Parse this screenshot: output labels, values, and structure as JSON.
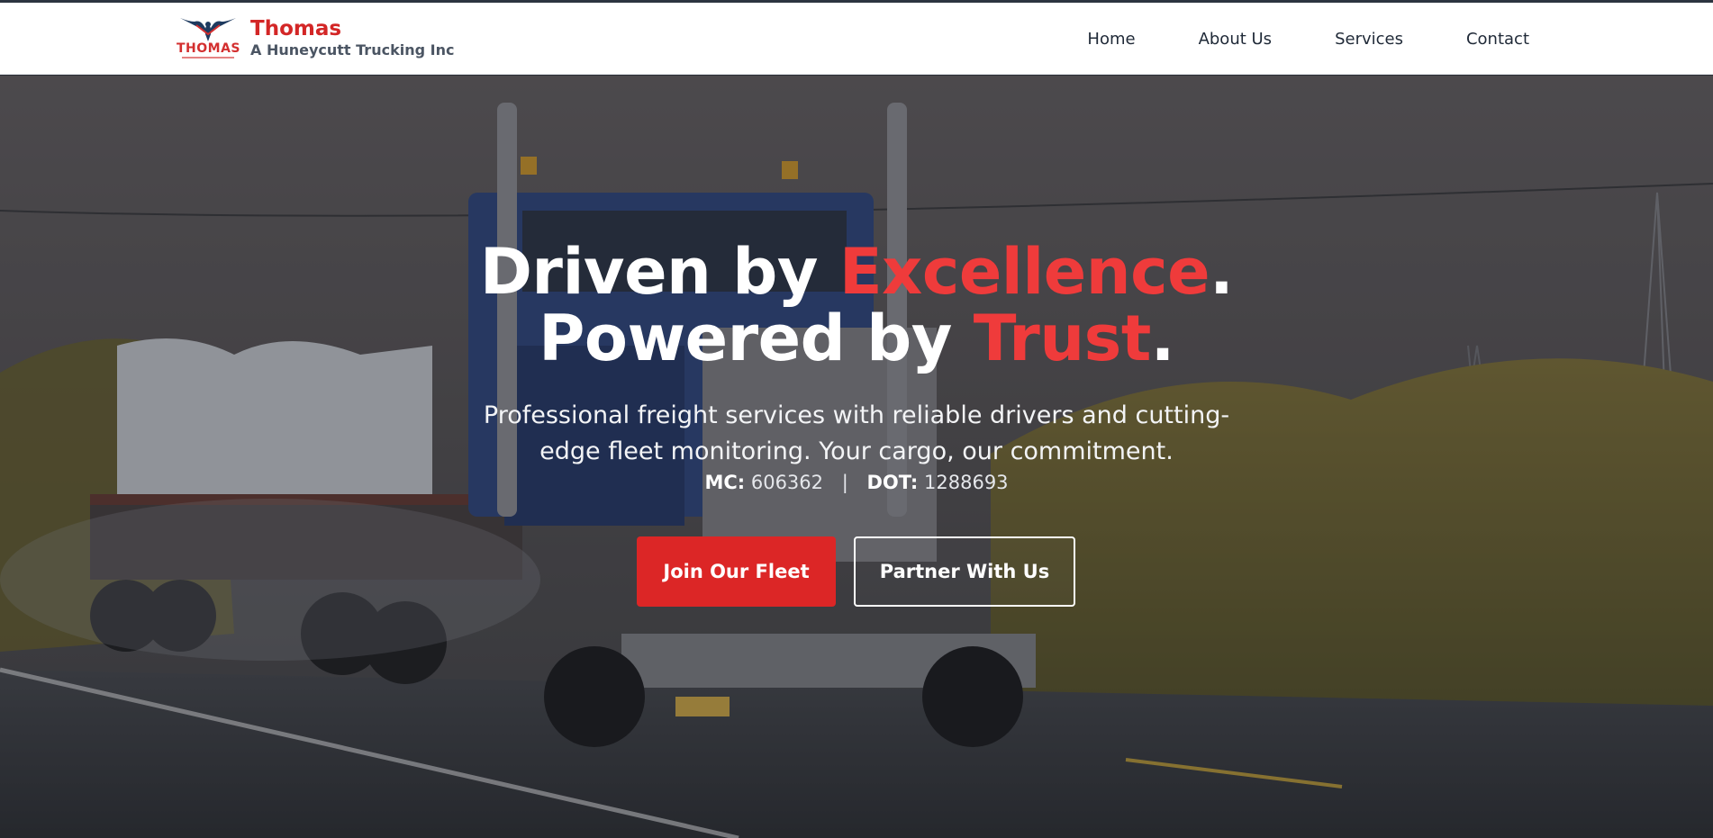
{
  "header": {
    "brand_name": "Thomas",
    "brand_sub": "A Huneycutt Trucking Inc",
    "logo_word": "THOMAS",
    "logo_icon": "eagle-icon",
    "nav": [
      {
        "label": "Home"
      },
      {
        "label": "About Us"
      },
      {
        "label": "Services"
      },
      {
        "label": "Contact"
      }
    ]
  },
  "hero": {
    "line1_a": "Driven by ",
    "line1_accent": "Excellence",
    "line1_end": ".",
    "line2_a": "Powered by ",
    "line2_accent": "Trust",
    "line2_end": ".",
    "lead": "Professional freight services with reliable drivers and cutting-edge fleet monitoring. Your cargo, our commitment.",
    "mc_label": "MC:",
    "mc_value": "606362",
    "separator": "|",
    "dot_label": "DOT:",
    "dot_value": "1288693",
    "primary_cta": "Join Our Fleet",
    "secondary_cta": "Partner With Us"
  },
  "colors": {
    "accent": "#dc2626",
    "accent_text": "#ef3b3b",
    "nav_text": "#1f2937"
  }
}
